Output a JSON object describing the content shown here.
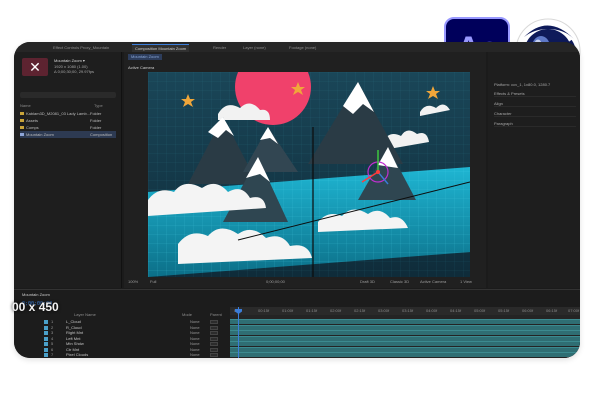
{
  "tabs": {
    "project_tab": "Effect Controls Proxy_Mountain",
    "composition_tab": "Composition Mountain Zoom",
    "render_tab": "Render",
    "layer_tab": "Layer (none)",
    "footage_tab": "Footage (none)"
  },
  "project": {
    "comp_name": "Mountain Zoom ▾",
    "comp_info_1": "1920 x 1080 (1.00)",
    "comp_info_2": "Δ 0;00;30;00, 29.97fps",
    "col_name": "Name",
    "col_type": "Type",
    "items": [
      {
        "name": "Kablam3D_M2081_03 Lady Lamb...",
        "type": "Folder",
        "selected": false
      },
      {
        "name": "Assets",
        "type": "Folder",
        "selected": false
      },
      {
        "name": "Comps",
        "type": "Folder",
        "selected": false
      },
      {
        "name": "Mountain Zoom",
        "type": "Composition",
        "selected": true
      }
    ]
  },
  "viewer": {
    "comp_tab": "Mountain Zoom",
    "camera_label": "Active Camera",
    "zoom": "100%",
    "resolution": "Full",
    "timecode": "0;00;00;00",
    "draft3d": "Draft 3D",
    "renderer": "Classic 3D",
    "view_camera": "Active Camera",
    "views": "1 View"
  },
  "right_panel": {
    "info_title": "Platform: ccv_1, 1x80.0, 1280.7",
    "items": [
      "Effects & Presets",
      "Align",
      "Character",
      "Paragraph"
    ]
  },
  "timeline": {
    "comp_tab": "Mountain Zoom",
    "current_time": "0;00;00;00",
    "col_layer_name": "Layer Name",
    "col_mode": "Mode",
    "col_parent": "Parent",
    "ruler": [
      "0:00",
      "00:15f",
      "01:00f",
      "01:15f",
      "02:00f",
      "02:15f",
      "03:00f",
      "03:15f",
      "04:00f",
      "04:15f",
      "05:00f",
      "05:15f",
      "06:00f",
      "06:15f",
      "07:00f"
    ],
    "layers": [
      {
        "num": "1",
        "name": "L_Cloud",
        "mode": "None"
      },
      {
        "num": "2",
        "name": "R_Cloud",
        "mode": "None"
      },
      {
        "num": "3",
        "name": "Right Mnt",
        "mode": "None"
      },
      {
        "num": "4",
        "name": "Left Mnt",
        "mode": "None"
      },
      {
        "num": "5",
        "name": "Mtn Shdw",
        "mode": "None"
      },
      {
        "num": "6",
        "name": "Ctr Mnt",
        "mode": "None"
      },
      {
        "num": "7",
        "name": "Pixel Clouds",
        "mode": "None"
      }
    ]
  },
  "overlay": {
    "size_label": "00 x 450"
  },
  "logos": {
    "after_effects": "Ae",
    "after_effects_bg": "#00005b",
    "after_effects_fg": "#9999ff",
    "cinema4d_icon": "cinema4d-icon"
  },
  "colors": {
    "accent": "#3b7dd8",
    "sun": "#f0416b",
    "sky": "#143a4a",
    "grid": "#1fb6d3",
    "star": "#f0a63a"
  }
}
